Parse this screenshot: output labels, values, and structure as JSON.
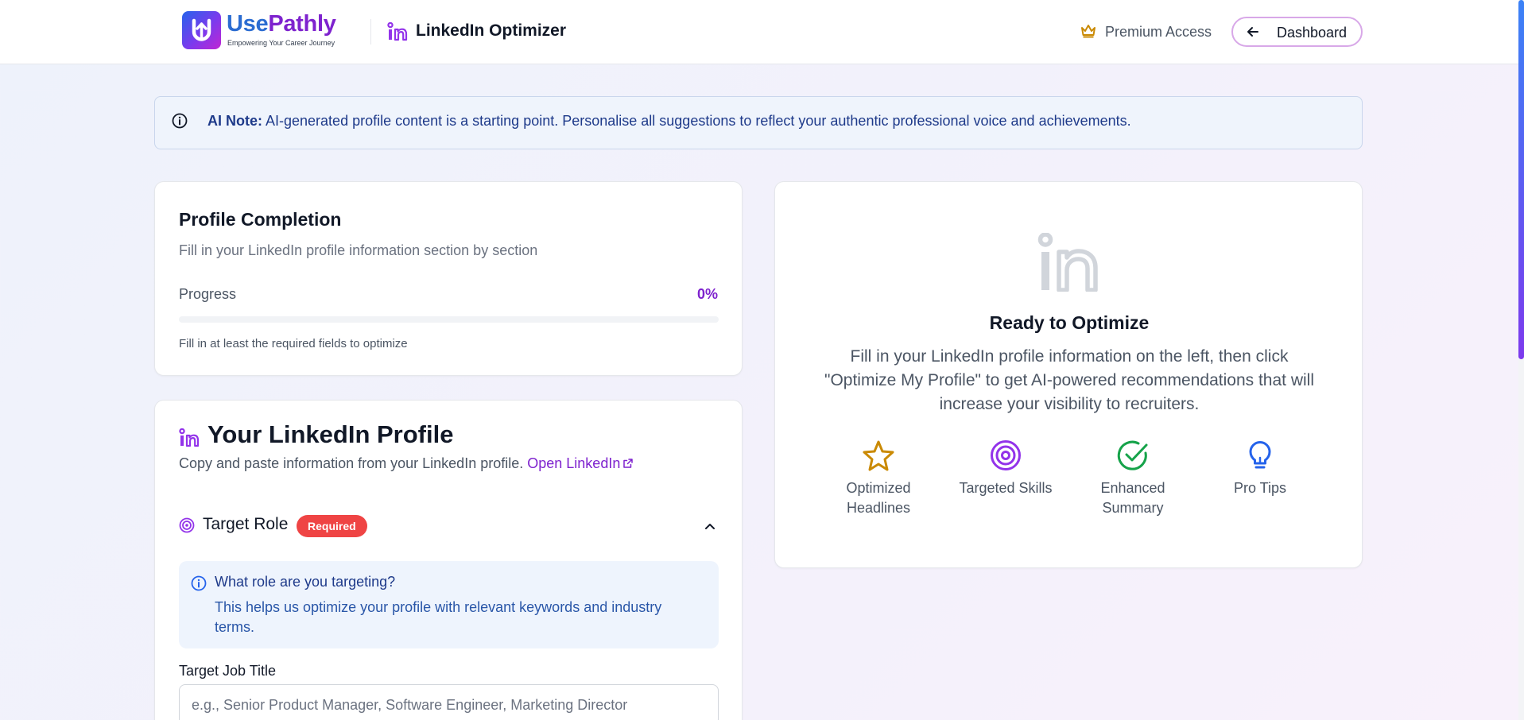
{
  "header": {
    "brand_use": "Use",
    "brand_pathly": "Pathly",
    "tagline": "Empowering Your Career Journey",
    "app_title": "LinkedIn Optimizer",
    "premium_label": "Premium Access",
    "dashboard_label": "Dashboard"
  },
  "ai_note": {
    "label": "AI Note:",
    "text": " AI-generated profile content is a starting point. Personalise all suggestions to reflect your authentic professional voice and achievements."
  },
  "completion": {
    "title": "Profile Completion",
    "subtitle": "Fill in your LinkedIn profile information section by section",
    "progress_label": "Progress",
    "progress_value": "0%",
    "progress_fraction": 0,
    "hint": "Fill in at least the required fields to optimize"
  },
  "profile": {
    "title": "Your LinkedIn Profile",
    "subtitle": "Copy and paste information from your LinkedIn profile.",
    "open_link": "Open LinkedIn",
    "target_role": {
      "label": "Target Role",
      "badge": "Required",
      "info_question": "What role are you targeting?",
      "info_desc": "This helps us optimize your profile with relevant keywords and industry terms.",
      "job_title_label": "Target Job Title",
      "job_title_value": "",
      "job_title_placeholder": "e.g., Senior Product Manager, Software Engineer, Marketing Director"
    }
  },
  "ready": {
    "title": "Ready to Optimize",
    "description": "Fill in your LinkedIn profile information on the left, then click \"Optimize My Profile\" to get AI-powered recommendations that will increase your visibility to recruiters.",
    "features": [
      {
        "icon": "star-icon",
        "label": "Optimized Headlines",
        "color": "#ca8a04"
      },
      {
        "icon": "target-icon",
        "label": "Targeted Skills",
        "color": "#9333ea"
      },
      {
        "icon": "check-circle-icon",
        "label": "Enhanced Summary",
        "color": "#16a34a"
      },
      {
        "icon": "lightbulb-icon",
        "label": "Pro Tips",
        "color": "#2563eb"
      }
    ]
  },
  "colors": {
    "accent": "#7e22ce",
    "brand_blue": "#2b6cd1",
    "required_badge": "#ef4444",
    "info_text": "#1e3a8a"
  }
}
